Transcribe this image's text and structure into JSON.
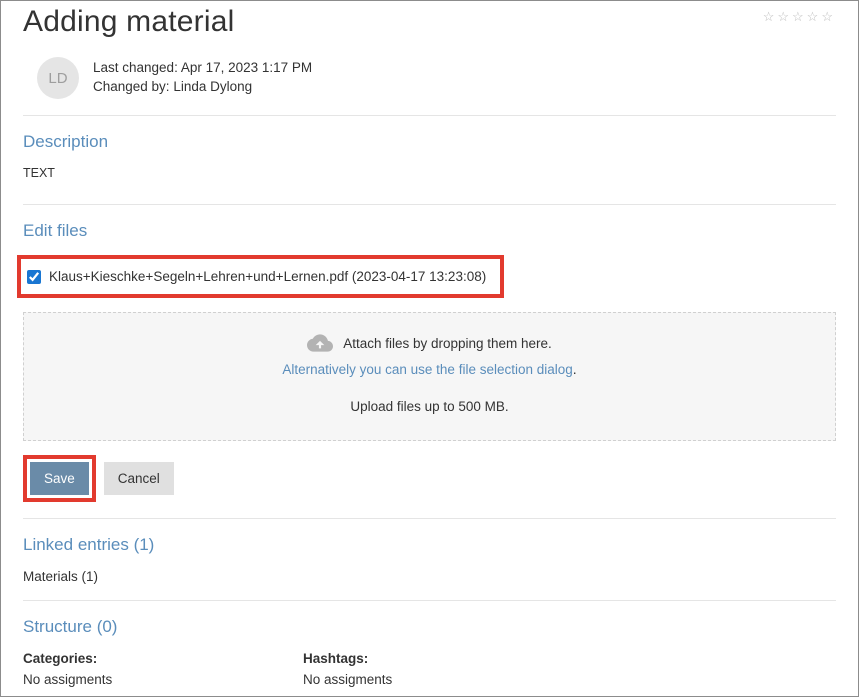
{
  "header": {
    "title": "Adding material",
    "stars_count": 5
  },
  "changed": {
    "avatar_initials": "LD",
    "last_changed_label": "Last changed:",
    "last_changed_value": "Apr 17, 2023 1:17 PM",
    "changed_by_label": "Changed by:",
    "changed_by_value": "Linda Dylong"
  },
  "description": {
    "title": "Description",
    "body": "TEXT"
  },
  "edit_files": {
    "title": "Edit files",
    "file": {
      "checked": true,
      "name": "Klaus+Kieschke+Segeln+Lehren+und+Lernen.pdf (2023-04-17 13:23:08)"
    },
    "drop": {
      "line1": "Attach files by dropping them here.",
      "link": "Alternatively you can use the file selection dialog",
      "link_suffix": ".",
      "size": "Upload files up to 500 MB."
    }
  },
  "buttons": {
    "save": "Save",
    "cancel": "Cancel"
  },
  "linked": {
    "title": "Linked entries (1)",
    "sub": "Materials (1)"
  },
  "structure": {
    "title": "Structure (0)",
    "categories_label": "Categories:",
    "categories_value": "No assigments",
    "hashtags_label": "Hashtags:",
    "hashtags_value": "No assigments"
  }
}
